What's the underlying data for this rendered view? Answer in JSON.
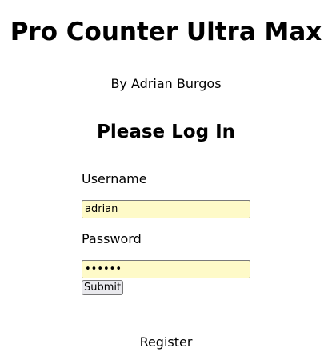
{
  "app": {
    "title": "Pro Counter Ultra Max",
    "byline": "By Adrian Burgos"
  },
  "login": {
    "heading": "Please Log In",
    "username_label": "Username",
    "username_value": "adrian",
    "password_label": "Password",
    "password_value": "••••••",
    "submit_label": "Submit"
  },
  "footer": {
    "register_label": "Register"
  },
  "colors": {
    "input_background": "#fefac8",
    "button_background": "#e9e9ed"
  }
}
